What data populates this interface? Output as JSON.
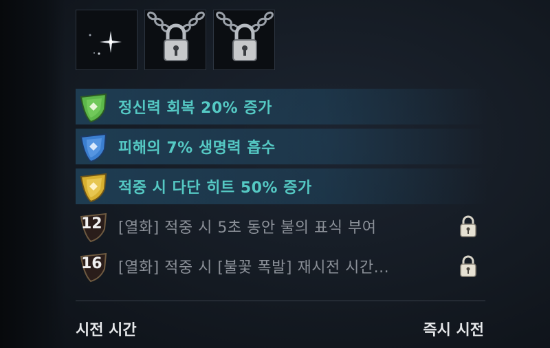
{
  "slots": [
    {
      "name": "sparkle-slot",
      "icon": "sparkle-icon",
      "state": "unlocked"
    },
    {
      "name": "locked-slot-1",
      "icon": "chain-padlock-icon",
      "state": "locked"
    },
    {
      "name": "locked-slot-2",
      "icon": "chain-padlock-icon",
      "state": "locked"
    }
  ],
  "effects": [
    {
      "icon": "green-crest-icon",
      "text": "정신력 회복 20% 증가",
      "color": "#5db84a"
    },
    {
      "icon": "blue-crest-icon",
      "text": "피해의 7% 생명력 흡수",
      "color": "#3b7fd0"
    },
    {
      "icon": "yellow-crest-icon",
      "text": "적중 시 다단 히트 50% 증가",
      "color": "#d7b030"
    }
  ],
  "locked_effects": [
    {
      "level": "12",
      "text": "[열화] 적중 시 5초 동안 불의 표식 부여",
      "icon": "padlock-icon"
    },
    {
      "level": "16",
      "text": "[열화] 적중 시 [불꽃 폭발] 재시전 시간...",
      "icon": "padlock-icon"
    }
  ],
  "footer": {
    "left": "시전 시간",
    "right": "즉시 시전"
  },
  "colors": {
    "active_text": "#55c9c4",
    "locked_text": "#8b9098"
  }
}
